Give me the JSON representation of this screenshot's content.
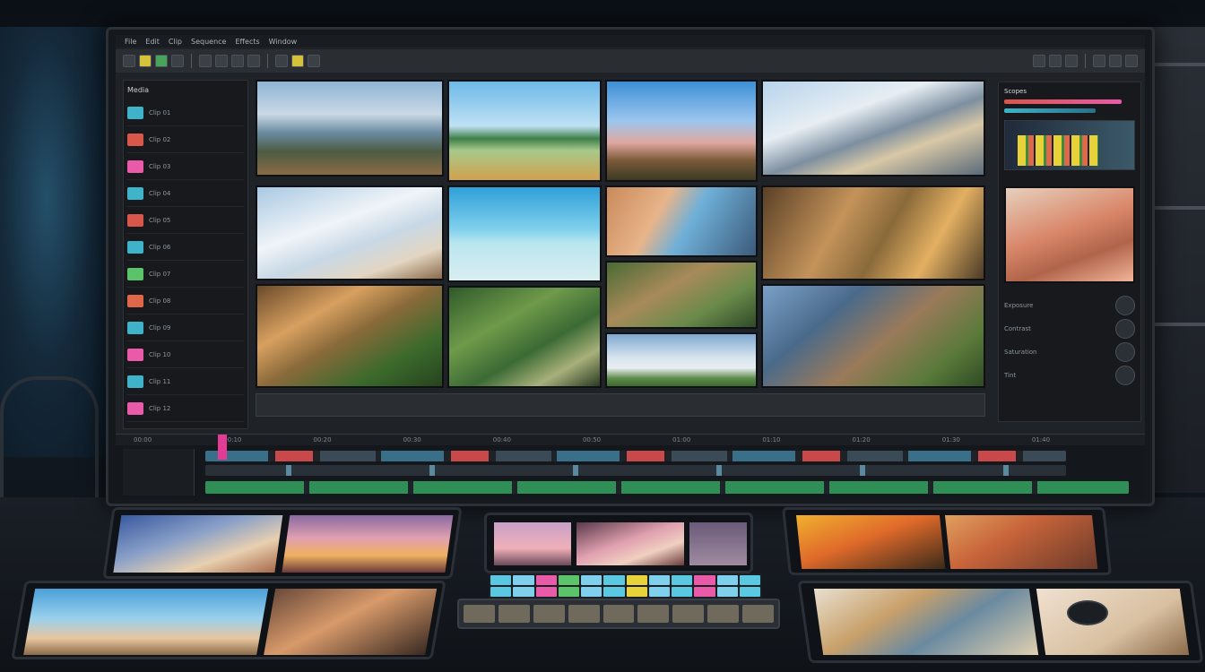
{
  "app": {
    "menu": [
      "File",
      "Edit",
      "Clip",
      "Sequence",
      "Effects",
      "Window"
    ]
  },
  "media_panel": {
    "title": "Media",
    "items": [
      {
        "label": "Clip 01",
        "color": "#3fb3c9"
      },
      {
        "label": "Clip 02",
        "color": "#d7574a"
      },
      {
        "label": "Clip 03",
        "color": "#e95aa8"
      },
      {
        "label": "Clip 04",
        "color": "#3fb3c9"
      },
      {
        "label": "Clip 05",
        "color": "#d7574a"
      },
      {
        "label": "Clip 06",
        "color": "#3fb3c9"
      },
      {
        "label": "Clip 07",
        "color": "#5bc46a"
      },
      {
        "label": "Clip 08",
        "color": "#e0674a"
      },
      {
        "label": "Clip 09",
        "color": "#3fb3c9"
      },
      {
        "label": "Clip 10",
        "color": "#e95aa8"
      },
      {
        "label": "Clip 11",
        "color": "#3fb3c9"
      },
      {
        "label": "Clip 12",
        "color": "#e95aa8"
      }
    ]
  },
  "inspector": {
    "title": "Scopes",
    "labels": [
      "Exposure",
      "Contrast",
      "Saturation",
      "Tint"
    ]
  },
  "timeline": {
    "ruler": [
      "00:00",
      "00:10",
      "00:20",
      "00:30",
      "00:40",
      "00:50",
      "01:00",
      "01:10",
      "01:20",
      "01:30",
      "01:40"
    ]
  },
  "colors": {
    "accent": "#e43c94",
    "audio_track": "#2f8f56",
    "video_track": "#3a6f8a"
  }
}
